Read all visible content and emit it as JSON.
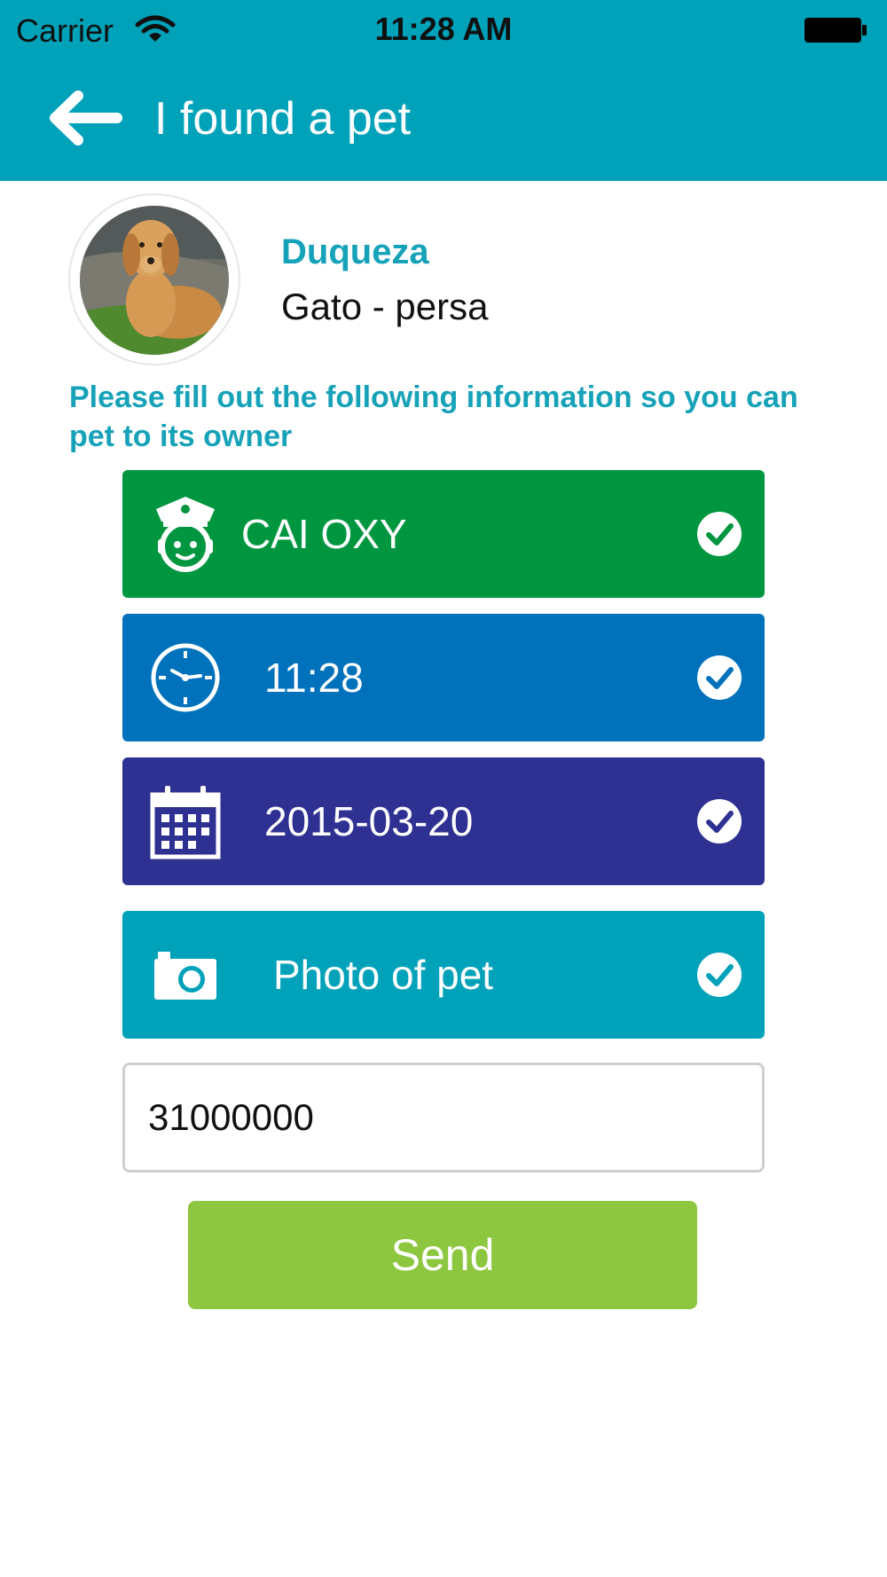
{
  "status_bar": {
    "carrier": "Carrier",
    "time": "11:28 AM",
    "wifi_icon": "wifi-icon",
    "battery_icon": "battery-icon"
  },
  "nav": {
    "back_icon": "arrow-left-icon",
    "title": "I found a pet"
  },
  "pet": {
    "name": "Duqueza",
    "breed": "Gato - persa",
    "avatar_icon": "dog-photo"
  },
  "instructions": "Please fill out the following information so you can pet to its owner",
  "rows": [
    {
      "icon": "police-officer-icon",
      "label": "CAI OXY",
      "color": "#009640",
      "completed": true
    },
    {
      "icon": "clock-icon",
      "label": "11:28",
      "color": "#0072bc",
      "completed": true
    },
    {
      "icon": "calendar-icon",
      "label": "2015-03-20",
      "color": "#2e3192",
      "completed": true
    },
    {
      "icon": "camera-icon",
      "label": "Photo of pet",
      "color": "#00a2ba",
      "completed": true
    }
  ],
  "phone_input": {
    "value": "31000000"
  },
  "send_label": "Send",
  "colors": {
    "accent": "#00a2ba",
    "send": "#8dc63f",
    "text_accent": "#16a2b8"
  }
}
